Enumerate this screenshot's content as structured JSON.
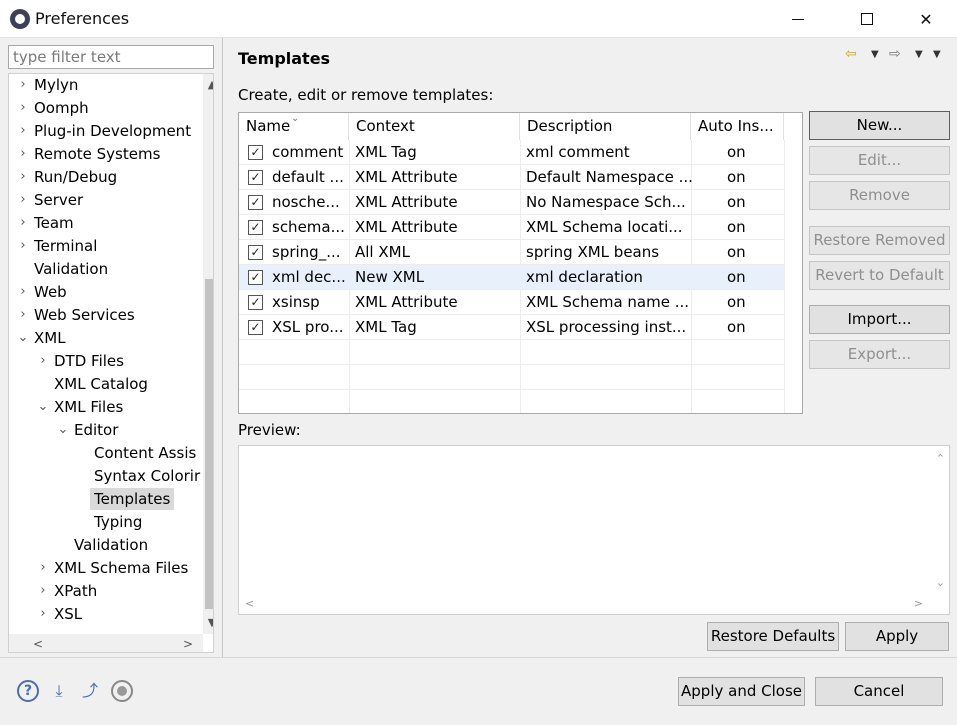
{
  "window": {
    "title": "Preferences"
  },
  "filter": {
    "placeholder": "type filter text"
  },
  "tree": {
    "items": [
      {
        "label": "Mylyn",
        "arrow": ">"
      },
      {
        "label": "Oomph",
        "arrow": ">"
      },
      {
        "label": "Plug-in Development",
        "arrow": ">"
      },
      {
        "label": "Remote Systems",
        "arrow": ">"
      },
      {
        "label": "Run/Debug",
        "arrow": ">"
      },
      {
        "label": "Server",
        "arrow": ">"
      },
      {
        "label": "Team",
        "arrow": ">"
      },
      {
        "label": "Terminal",
        "arrow": ">"
      },
      {
        "label": "Validation",
        "arrow": ""
      },
      {
        "label": "Web",
        "arrow": ">"
      },
      {
        "label": "Web Services",
        "arrow": ">"
      },
      {
        "label": "XML",
        "arrow": "v"
      },
      {
        "label": "DTD Files",
        "arrow": ">"
      },
      {
        "label": "XML Catalog",
        "arrow": ""
      },
      {
        "label": "XML Files",
        "arrow": "v"
      },
      {
        "label": "Editor",
        "arrow": "v"
      },
      {
        "label": "Content Assis",
        "arrow": ""
      },
      {
        "label": "Syntax Colorir",
        "arrow": ""
      },
      {
        "label": "Templates",
        "arrow": ""
      },
      {
        "label": "Typing",
        "arrow": ""
      },
      {
        "label": "Validation",
        "arrow": ""
      },
      {
        "label": "XML Schema Files",
        "arrow": ">"
      },
      {
        "label": "XPath",
        "arrow": ">"
      },
      {
        "label": "XSL",
        "arrow": ">"
      }
    ]
  },
  "page": {
    "title": "Templates",
    "description": "Create, edit or remove templates:",
    "preview_label": "Preview:"
  },
  "table": {
    "columns": [
      "Name",
      "Context",
      "Description",
      "Auto Ins..."
    ],
    "rows": [
      {
        "checked": true,
        "name": "comment",
        "context": "XML Tag",
        "description": "xml comment",
        "auto": "on"
      },
      {
        "checked": true,
        "name": "default ...",
        "context": "XML Attribute",
        "description": "Default Namespace ...",
        "auto": "on"
      },
      {
        "checked": true,
        "name": "nosche...",
        "context": "XML Attribute",
        "description": "No Namespace Sch...",
        "auto": "on"
      },
      {
        "checked": true,
        "name": "schema...",
        "context": "XML Attribute",
        "description": "XML Schema locati...",
        "auto": "on"
      },
      {
        "checked": true,
        "name": "spring_...",
        "context": "All XML",
        "description": "spring XML beans",
        "auto": "on"
      },
      {
        "checked": true,
        "name": "xml dec...",
        "context": "New XML",
        "description": "xml declaration",
        "auto": "on"
      },
      {
        "checked": true,
        "name": "xsinsp",
        "context": "XML Attribute",
        "description": "XML Schema name ...",
        "auto": "on"
      },
      {
        "checked": true,
        "name": "XSL pro...",
        "context": "XML Tag",
        "description": "XSL processing inst...",
        "auto": "on"
      }
    ]
  },
  "buttons": {
    "new": "New...",
    "edit": "Edit...",
    "remove": "Remove",
    "restore_removed": "Restore Removed",
    "revert_default": "Revert to Default",
    "import": "Import...",
    "export": "Export...",
    "restore_defaults": "Restore Defaults",
    "apply": "Apply",
    "apply_close": "Apply and Close",
    "cancel": "Cancel"
  },
  "icons": {
    "help": "help-icon",
    "import_prefs": "import-preferences-icon",
    "export_prefs": "export-preferences-icon",
    "record": "record-icon"
  }
}
